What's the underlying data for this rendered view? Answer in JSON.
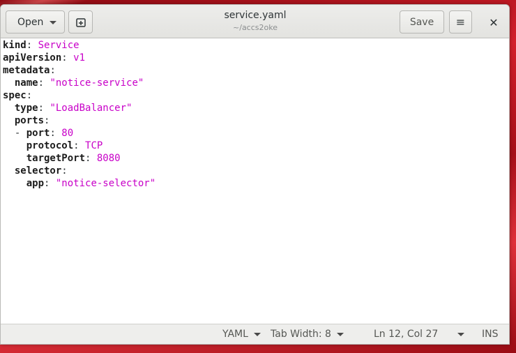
{
  "window": {
    "title": "service.yaml",
    "subtitle": "~/accs2oke"
  },
  "toolbar": {
    "open_label": "Open",
    "save_label": "Save",
    "close_glyph": "✕",
    "menu_glyph": "≡"
  },
  "editor": {
    "lines": [
      {
        "indent": "",
        "key": "kind",
        "sep": ": ",
        "value": "Service"
      },
      {
        "indent": "",
        "key": "apiVersion",
        "sep": ": ",
        "value": "v1"
      },
      {
        "indent": "",
        "key": "metadata",
        "sep": ":",
        "value": ""
      },
      {
        "indent": "  ",
        "key": "name",
        "sep": ": ",
        "value": "\"notice-service\""
      },
      {
        "indent": "",
        "key": "spec",
        "sep": ":",
        "value": ""
      },
      {
        "indent": "  ",
        "key": "type",
        "sep": ": ",
        "value": "\"LoadBalancer\""
      },
      {
        "indent": "  ",
        "key": "ports",
        "sep": ":",
        "value": ""
      },
      {
        "indent": "  - ",
        "key": "port",
        "sep": ": ",
        "value": "80"
      },
      {
        "indent": "    ",
        "key": "protocol",
        "sep": ": ",
        "value": "TCP"
      },
      {
        "indent": "    ",
        "key": "targetPort",
        "sep": ": ",
        "value": "8080"
      },
      {
        "indent": "  ",
        "key": "selector",
        "sep": ":",
        "value": ""
      },
      {
        "indent": "    ",
        "key": "app",
        "sep": ": ",
        "value": "\"notice-selector\""
      }
    ]
  },
  "statusbar": {
    "language": "YAML",
    "tab_width": "Tab Width: 8",
    "position": "Ln 12, Col 27",
    "mode": "INS"
  },
  "colors": {
    "value": "#c800c8",
    "desktop": "#b8121c"
  }
}
